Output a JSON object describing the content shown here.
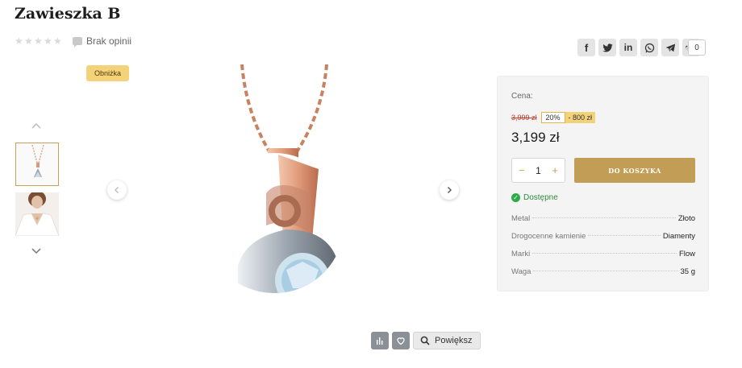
{
  "product": {
    "title": "Zawieszka B"
  },
  "rating": {
    "stars": 0,
    "max": 5,
    "reviews_label": "Brak opinii"
  },
  "share": {
    "buttons": [
      "facebook-icon",
      "twitter-icon",
      "linkedin-icon",
      "whatsapp-icon",
      "telegram-icon",
      "more-icon"
    ],
    "count": "0"
  },
  "gallery": {
    "badge": "Obniżka",
    "thumbnails": [
      "pendant-thumbnail",
      "model-thumbnail"
    ]
  },
  "tools": {
    "zoom_label": "Powiększ"
  },
  "buy": {
    "price_label": "Cena:",
    "old_price": "3,999 zł",
    "discount_pct": "20%",
    "discount_amount": "- 800 zł",
    "price": "3,199 zł",
    "quantity": "1",
    "minus": "−",
    "plus": "+",
    "cart_label": "DO KOSZYKA",
    "stock": "Dostępne"
  },
  "specs": [
    {
      "name": "Metal",
      "value": "Złoto"
    },
    {
      "name": "Drogocenne kamienie",
      "value": "Diamenty"
    },
    {
      "name": "Marki",
      "value": "Flow"
    },
    {
      "name": "Waga",
      "value": "35 g"
    }
  ],
  "colors": {
    "accent": "#c29d55",
    "badge": "#f4d27a",
    "stock": "#2eaa4a"
  }
}
